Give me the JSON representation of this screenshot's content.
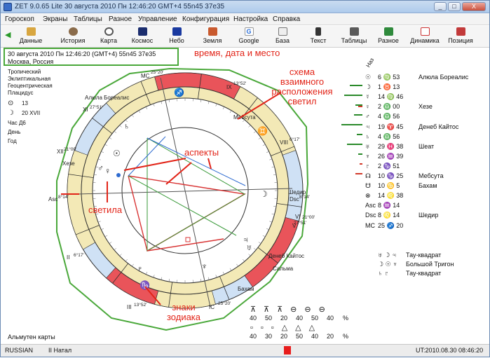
{
  "window": {
    "title": "ZET 9.0.65 Lite   30 августа 2010  Пн  12:46:20 GMT+4  55n45  37e35",
    "minimize_label": "_",
    "maximize_label": "□",
    "close_label": "X"
  },
  "menu": [
    "Гороскоп",
    "Экраны",
    "Таблицы",
    "Разное",
    "Управление",
    "Конфигурация",
    "Настройка",
    "Справка"
  ],
  "toolbar": [
    "Данные",
    "История",
    "Карта",
    "Космос",
    "Небо",
    "Земля",
    "Google",
    "База",
    "Текст",
    "Таблицы",
    "Разное",
    "Динамика",
    "Позиция"
  ],
  "info": {
    "line1": "30 августа 2010  Пн  12:46:20 (GMT+4)  55n45  37e35",
    "line2": "Москва, Россия"
  },
  "left_panel": {
    "lines": [
      "Тропический",
      "Эклиптикальная",
      "Геоцентрическая",
      "Плацидус"
    ],
    "moon_phase_icon": "moon-phase-icon",
    "moon_phase_value": "13",
    "sun_icon": "sun-icon",
    "sun_value": "20 XVII",
    "hour_label": "Час Д6",
    "day_label": "День",
    "year_label": "Год",
    "almuten": "Альмутен карты"
  },
  "annotations": {
    "time_place": "время, дата и место",
    "scheme": "схема\nвзаимного\nрасположения\nсветил",
    "aspects": "аспекты",
    "lights": "светила",
    "signs": "знаки\nзодиака"
  },
  "chart_labels": {
    "mc": "MC",
    "mc_deg": "25°20'",
    "ic": "IC",
    "ic_deg": "25°20'",
    "asc": "Asc",
    "asc_deg": "8°14'",
    "dsc": "Dsc",
    "dsc_deg": "8°14'",
    "h9": "IX",
    "h9_deg": "13°52'",
    "h8": "VIII",
    "h8_deg": "6°17'",
    "h11": "XI",
    "h11_deg": "27°51'",
    "h12": "XII",
    "h12_deg": "21°00'",
    "h2": "II",
    "h2_deg": "6°17'",
    "h3": "III",
    "h3_deg": "13°52'",
    "h5": "V",
    "h5_deg": "27°51'",
    "h6": "VI",
    "h6_deg": "21°00'",
    "star_aludra": "Алюла Бореалис",
    "star_mebsuta": "Мебсута",
    "star_heze": "Хезе",
    "star_shedir": "Шедир",
    "star_deneb": "Денеб Кайтос",
    "star_salma": "Сальма",
    "star_bekham": "Бахам"
  },
  "right_panel": {
    "header": "Наз",
    "rows": [
      {
        "sym": "☉",
        "val": "6 ♍ 53",
        "name": "Алюла Бореалис"
      },
      {
        "sym": "☽",
        "val": "1 ♉ 13",
        "name": ""
      },
      {
        "sym": "☿",
        "val": "14 ♍ 46",
        "name": ""
      },
      {
        "sym": "♀",
        "val": "2 ♎ 00",
        "name": "Хезе"
      },
      {
        "sym": "♂",
        "val": "4 ♎ 56",
        "name": ""
      },
      {
        "sym": "♃",
        "val": "19 ♈ 45",
        "name": "Денеб Кайтос"
      },
      {
        "sym": "♄",
        "val": "4 ♎ 56",
        "name": ""
      },
      {
        "sym": "♅",
        "val": "29 ♓ 38",
        "name": "Шеат"
      },
      {
        "sym": "♆",
        "val": "26 ♒ 39",
        "name": ""
      },
      {
        "sym": "♇",
        "val": "2 ♑ 51",
        "name": ""
      },
      {
        "sym": "☊",
        "val": "10 ♑ 25",
        "name": "Мебсута"
      },
      {
        "sym": "☋",
        "val": "10 ♋ 5",
        "name": "Бахам"
      },
      {
        "sym": "⊗",
        "val": "14 ♌ 38",
        "name": ""
      },
      {
        "sym": "Asc",
        "val": "8 ♒ 14",
        "name": ""
      },
      {
        "sym": "Dsc",
        "val": "8 ♌ 14",
        "name": "Шедир"
      },
      {
        "sym": "MC",
        "val": "25 ♐ 20",
        "name": ""
      }
    ],
    "configs": [
      {
        "sym": "♅ ☽ ♃",
        "name": "Тау-квадрат"
      },
      {
        "sym": "☽ ☉ ♆",
        "name": "Большой Тригон"
      },
      {
        "sym": "♄ ♇",
        "name": "Тау-квадрат"
      }
    ]
  },
  "element_stats": {
    "row1": [
      "40",
      "50",
      "20",
      "40",
      "50",
      "40",
      "%"
    ],
    "row2": [
      "40",
      "30",
      "20",
      "50",
      "40",
      "20",
      "%"
    ]
  },
  "status": {
    "lang": "RUSSIAN",
    "mode": "II Натал",
    "right": "UT:2010.08.30  08:46:20"
  },
  "colors": {
    "annotation": "#e22418",
    "highlight_frame": "#4aa83a",
    "sign_ring": "#f3e9b6",
    "house_ring": "#c9dcf3",
    "wedge_red": "#e9545a"
  }
}
